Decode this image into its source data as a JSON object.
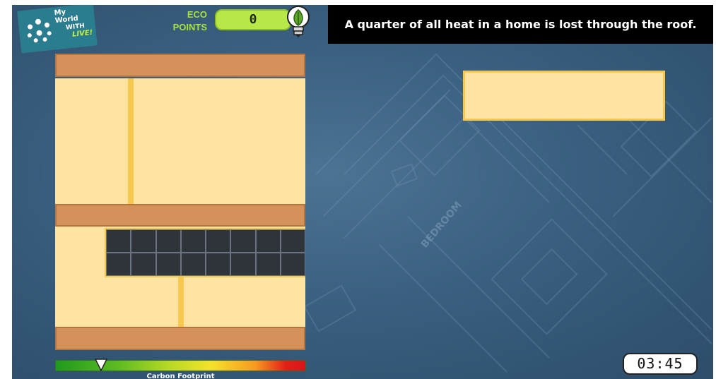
{
  "logo": {
    "line1": "My",
    "line2": "World",
    "line3": "WITH",
    "line4": "LIVE!"
  },
  "eco": {
    "label_line1": "ECO",
    "label_line2": "POINTS",
    "points": "0",
    "icon": "lightbulb-leaf-icon"
  },
  "fact": "A quarter of all heat in a home is lost through the roof.",
  "blueprint": {
    "room_label": "BEDROOM"
  },
  "carbon_meter": {
    "label": "Carbon Footprint",
    "level": 0.17,
    "colors": [
      "#1f9a1f",
      "#f4e22c",
      "#d9141a"
    ]
  },
  "timer": "03:45"
}
